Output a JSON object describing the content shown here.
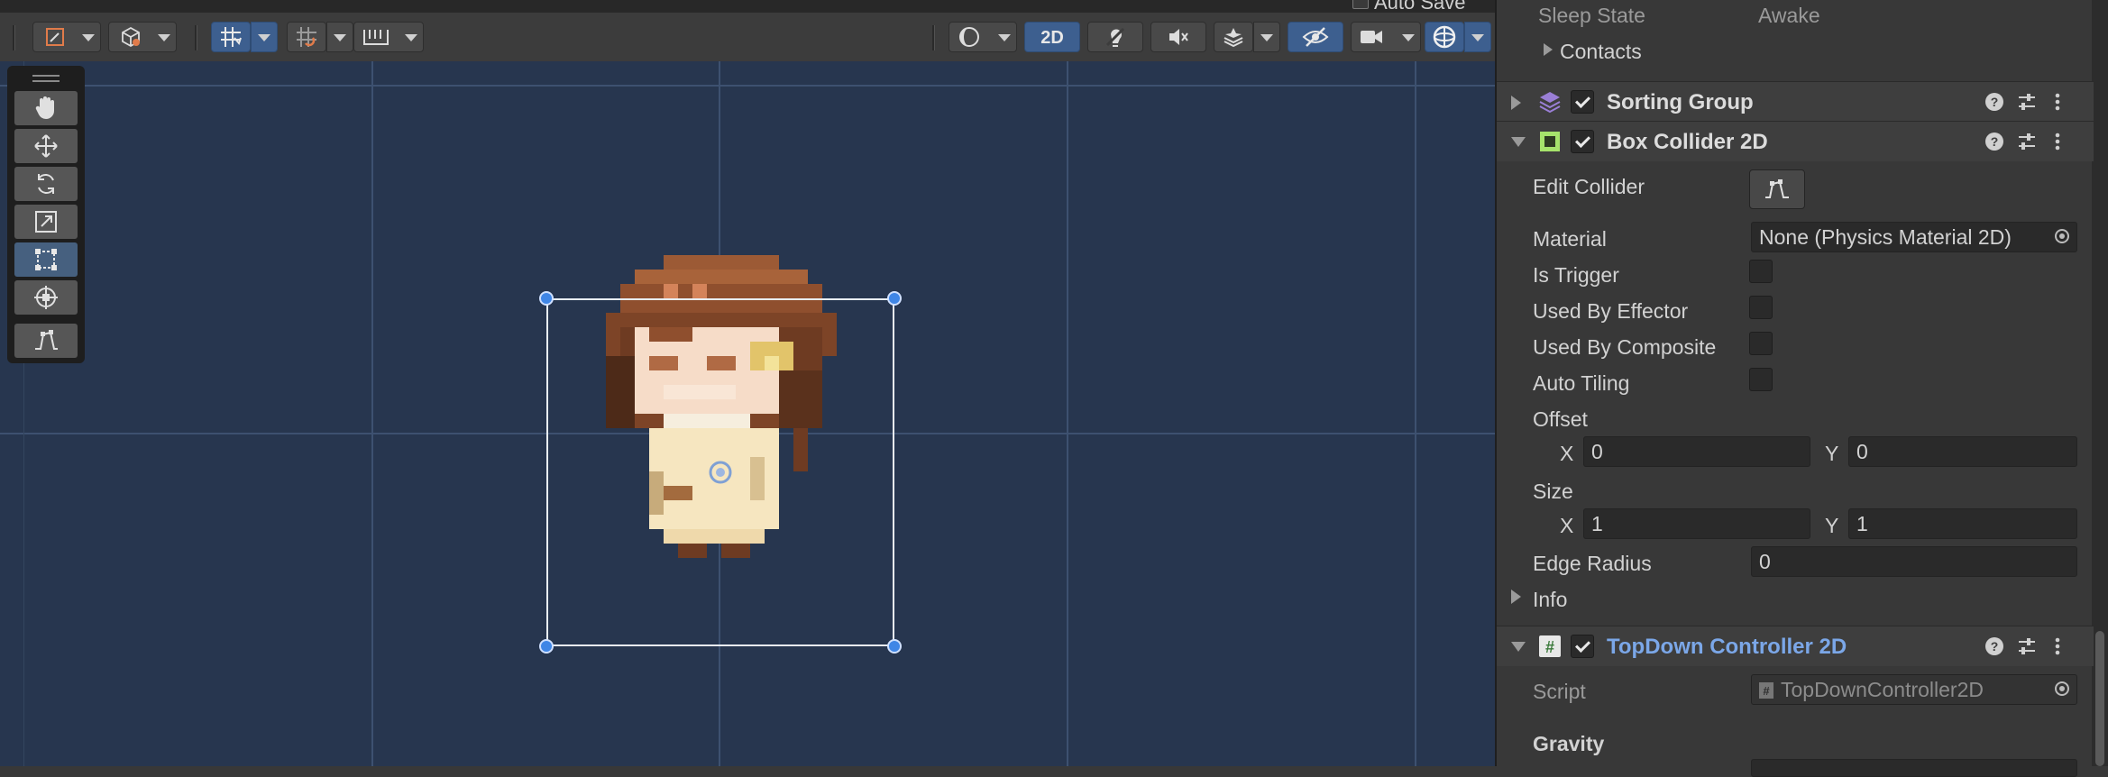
{
  "scene": {
    "autosave_label": "Auto Save",
    "toolbar": {
      "mode_2d_label": "2D"
    },
    "tools": [
      "hand-tool",
      "move-tool",
      "rotate-tool",
      "scale-tool",
      "rect-tool",
      "transform-tool",
      "edit-collider-tool"
    ],
    "active_tool": "rect-tool"
  },
  "inspector": {
    "rigidbody": {
      "sleep_state_label": "Sleep State",
      "sleep_state_value": "Awake",
      "contacts_label": "Contacts"
    },
    "sorting_group": {
      "title": "Sorting Group",
      "enabled": true
    },
    "box_collider": {
      "title": "Box Collider 2D",
      "enabled": true,
      "edit_collider_label": "Edit Collider",
      "material_label": "Material",
      "material_value": "None (Physics Material 2D)",
      "is_trigger_label": "Is Trigger",
      "used_by_effector_label": "Used By Effector",
      "used_by_composite_label": "Used By Composite",
      "auto_tiling_label": "Auto Tiling",
      "offset_label": "Offset",
      "offset_x": "0",
      "offset_y": "0",
      "size_label": "Size",
      "size_x": "1",
      "size_y": "1",
      "edge_radius_label": "Edge Radius",
      "edge_radius_value": "0",
      "info_label": "Info",
      "axis_x": "X",
      "axis_y": "Y"
    },
    "topdown": {
      "title": "TopDown Controller 2D",
      "enabled": true,
      "script_label": "Script",
      "script_value": "TopDownController2D",
      "gravity_label": "Gravity"
    }
  },
  "colors": {
    "scene_bg": "#27364f",
    "accent_blue": "#3d5f8f",
    "handle_blue": "#3f86e6",
    "link_blue": "#7ba7e8"
  }
}
